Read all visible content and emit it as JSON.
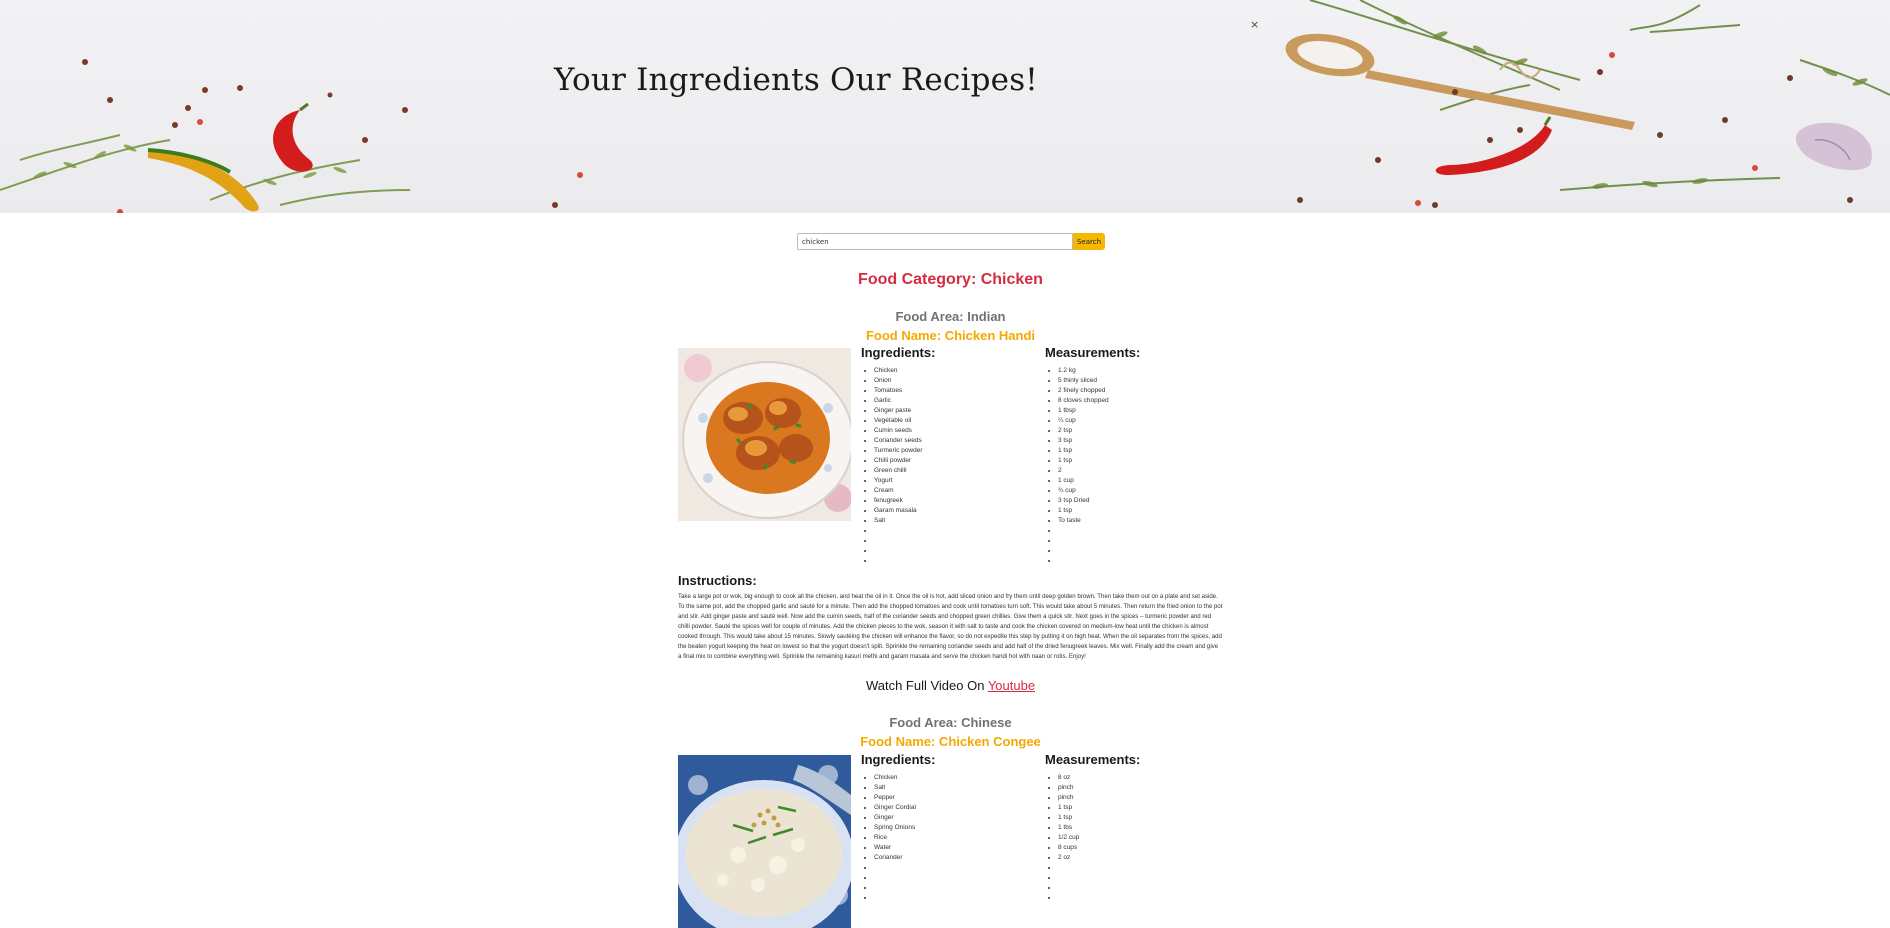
{
  "hero": {
    "title": "Your Ingredients Our Recipes!",
    "close_label": "×"
  },
  "search": {
    "value": "chicken",
    "button_label": "Search"
  },
  "category_title": "Food Category: Chicken",
  "colors": {
    "accent_red": "#d62c3f",
    "accent_yellow": "#f5a800",
    "search_button": "#f5b800"
  },
  "recipes": [
    {
      "area": "Food Area: Indian",
      "name": "Food Name: Chicken Handi",
      "ingredients_heading": "Ingredients:",
      "measurements_heading": "Measurements:",
      "ingredients": [
        "Chicken",
        "Onion",
        "Tomatoes",
        "Garlic",
        "Ginger paste",
        "Vegetable oil",
        "Cumin seeds",
        "Coriander seeds",
        "Turmeric powder",
        "Chilli powder",
        "Green chilli",
        "Yogurt",
        "Cream",
        "fenugreek",
        "Garam masala",
        "Salt",
        "",
        "",
        "",
        ""
      ],
      "measurements": [
        "1.2 kg",
        "5 thinly sliced",
        "2 finely chopped",
        "8 cloves chopped",
        "1 tbsp",
        "¼ cup",
        "2 tsp",
        "3 tsp",
        "1 tsp",
        "1 tsp",
        "2",
        "1 cup",
        "¾ cup",
        "3 tsp Dried",
        "1 tsp",
        "To taste",
        "",
        "",
        "",
        ""
      ],
      "instructions_heading": "Instructions:",
      "instructions": "Take a large pot or wok, big enough to cook all the chicken, and heat the oil in it. Once the oil is hot, add sliced onion and fry them until deep golden brown. Then take them out on a plate and set aside. To the same pot, add the chopped garlic and sauté for a minute. Then add the chopped tomatoes and cook until tomatoes turn soft. This would take about 5 minutes. Then return the fried onion to the pot and stir. Add ginger paste and sauté well. Now add the cumin seeds, half of the coriander seeds and chopped green chillies. Give them a quick stir. Next goes in the spices – turmeric powder and red chilli powder. Sauté the spices well for couple of minutes. Add the chicken pieces to the wok, season it with salt to taste and cook the chicken covered on medium-low heat until the chicken is almost cooked through. This would take about 15 minutes. Slowly sautéing the chicken will enhance the flavor, so do not expedite this step by putting it on high heat. When the oil separates from the spices, add the beaten yogurt keeping the heat on lowest so that the yogurt doesn't split. Sprinkle the remaining coriander seeds and add half of the dried fenugreek leaves. Mix well. Finally add the cream and give a final mix to combine everything well. Sprinkle the remaining kasuri methi and garam masala and serve the chicken handi hot with naan or rotis. Enjoy!",
      "video_prefix": "Watch Full Video On ",
      "video_link": "Youtube"
    },
    {
      "area": "Food Area: Chinese",
      "name": "Food Name: Chicken Congee",
      "ingredients_heading": "Ingredients:",
      "measurements_heading": "Measurements:",
      "ingredients": [
        "Chicken",
        "Salt",
        "Pepper",
        "Ginger Cordial",
        "Ginger",
        "Spring Onions",
        "Rice",
        "Water",
        "Coriander",
        "",
        "",
        "",
        ""
      ],
      "measurements": [
        "8 oz",
        "pinch",
        "pinch",
        "1 tsp",
        "1 tsp",
        "1 tbs",
        "1/2 cup",
        "8 cups",
        "2 oz",
        "",
        "",
        "",
        ""
      ]
    }
  ]
}
